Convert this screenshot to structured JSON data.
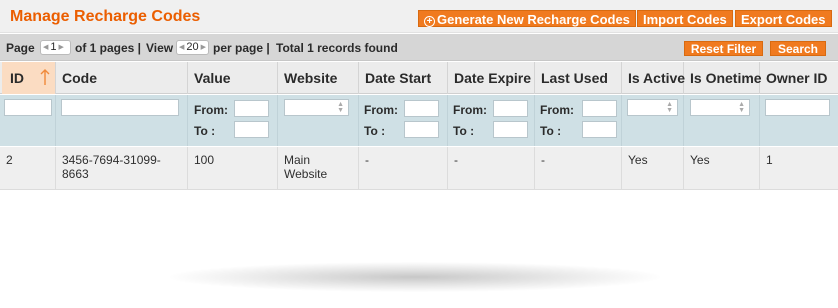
{
  "header": {
    "title": "Manage Recharge Codes",
    "buttons": {
      "generate": "Generate New Recharge Codes",
      "import": "Import Codes",
      "export": "Export Codes"
    }
  },
  "pager": {
    "page_label": "Page",
    "page_value": "1",
    "of_pages": "of 1 pages |",
    "view_label": "View",
    "view_value": "20",
    "per_page": "per page |",
    "total": "Total 1 records found",
    "reset_filter": "Reset Filter",
    "search": "Search"
  },
  "columns": [
    "ID",
    "Code",
    "Value",
    "Website",
    "Date Start",
    "Date Expire",
    "Last Used",
    "Is Active",
    "Is Onetime",
    "Owner ID"
  ],
  "sort": {
    "column": "ID",
    "direction": "ascending"
  },
  "filters": {
    "from_label": "From:",
    "to_label": "To :"
  },
  "rows": [
    {
      "id": "2",
      "code": "3456-7694-31099-8663",
      "value": "100",
      "website": "Main Website",
      "date_start": "-",
      "date_expire": "-",
      "last_used": "-",
      "is_active": "Yes",
      "is_onetime": "Yes",
      "owner_id": "1"
    }
  ],
  "colors": {
    "accent": "#f07a1f",
    "title": "#eb5e00",
    "filter_bg": "#cfe0e5",
    "sorted_header": "#fbdcc2"
  }
}
